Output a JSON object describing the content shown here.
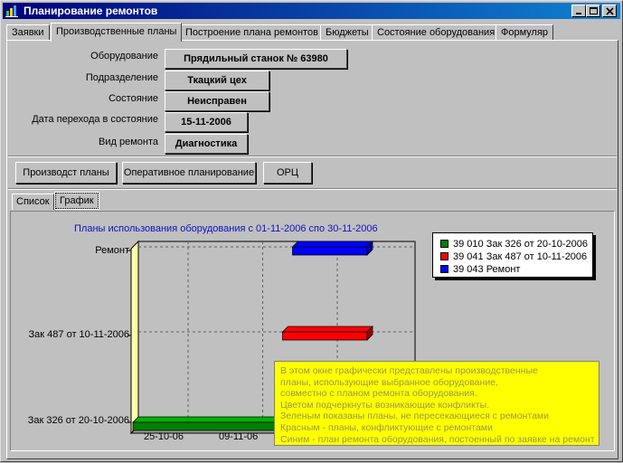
{
  "window": {
    "title": "Планирование ремонтов"
  },
  "tabs": [
    {
      "label": "Заявки"
    },
    {
      "label": "Производственные планы"
    },
    {
      "label": "Построение плана ремонтов"
    },
    {
      "label": "Бюджеты"
    },
    {
      "label": "Состояние оборудования"
    },
    {
      "label": "Формуляр"
    }
  ],
  "fields": [
    {
      "label": "Оборудование",
      "value": "Прядильный станок № 63980"
    },
    {
      "label": "Подразделение",
      "value": "Ткацкий цех"
    },
    {
      "label": "Состояние",
      "value": "Неисправен"
    },
    {
      "label": "Дата перехода в состояние",
      "value": "15-11-2006"
    },
    {
      "label": "Вид ремонта",
      "value": "Диагностика"
    }
  ],
  "actions": {
    "production_plans": "Производст планы",
    "operational_planning": "Оперативное планирование",
    "orc": "ОРЦ"
  },
  "subtabs": [
    {
      "label": "Список"
    },
    {
      "label": "График"
    }
  ],
  "chart_data": {
    "type": "gantt",
    "title": "Планы использования оборудования с 01-11-2006 спо 30-11-2006",
    "categories": [
      "Ремонт",
      "Зак 487 от 10-11-2006",
      "Зак 326 от 20-10-2006"
    ],
    "x_tick_labels": [
      "25-10-06",
      "09-11-06"
    ],
    "series": [
      {
        "name": "39 010 Зак 326 от 20-10-2006",
        "color": "#008000",
        "category": "Зак 326 от 20-10-2006",
        "start": "2006-10-20",
        "end": "2006-11-30"
      },
      {
        "name": "39 041 Зак 487 от 10-11-2006",
        "color": "#ff0000",
        "category": "Зак 487 от 10-11-2006",
        "start": "2006-11-13",
        "end": "2006-11-30"
      },
      {
        "name": "39 043 Ремонт",
        "color": "#0000ff",
        "category": "Ремонт",
        "start": "2006-11-15",
        "end": "2006-11-30"
      }
    ],
    "legend_position": "top-right",
    "grid": true
  },
  "tooltip": {
    "lines": [
      "В этом окне графически представлены производственные",
      "планы, использующие выбранное оборудование,",
      "совместно с планом ремонта оборудования.",
      "Цветом подчеркнуты возникающие конфликты.",
      "Зеленым показаны планы, не пересекающиеся с ремонтами",
      "Красным - планы, конфликтующие с ремонтами",
      "Синим - план ремонта оборудования, постоенный по заявке на ремонт"
    ]
  }
}
